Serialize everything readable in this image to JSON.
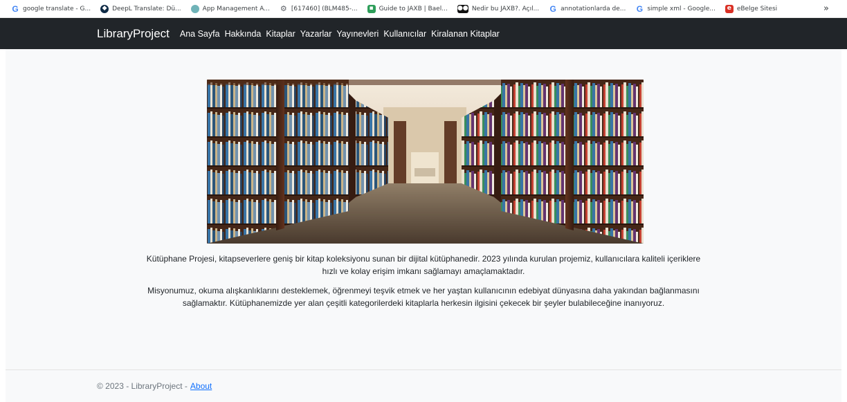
{
  "bookmarks": [
    {
      "label": "google translate - G...",
      "icon": "google-icon"
    },
    {
      "label": "DeepL Translate: Dü...",
      "icon": "deepl-icon"
    },
    {
      "label": "App Management A...",
      "icon": "app-icon"
    },
    {
      "label": "[617460] (BLM485-...",
      "icon": "gear-icon"
    },
    {
      "label": "Guide to JAXB | Bael...",
      "icon": "baeldung-icon"
    },
    {
      "label": "Nedir bu JAXB?. Açıl...",
      "icon": "medium-icon"
    },
    {
      "label": "annotationlarda de...",
      "icon": "google-icon"
    },
    {
      "label": "simple xml - Google...",
      "icon": "google-icon"
    },
    {
      "label": "eBelge Sitesi",
      "icon": "ebelge-icon"
    }
  ],
  "bookmarks_more": "»",
  "navbar": {
    "brand": "LibraryProject",
    "links": [
      "Ana Sayfa",
      "Hakkında",
      "Kitaplar",
      "Yazarlar",
      "Yayınevleri",
      "Kullanıcılar",
      "Kiralanan Kitaplar"
    ]
  },
  "content": {
    "paragraph1": "Kütüphane Projesi, kitapseverlere geniş bir kitap koleksiyonu sunan bir dijital kütüphanedir. 2023 yılında kurulan projemiz, kullanıcılara kaliteli içeriklere hızlı ve kolay erişim imkanı sağlamayı amaçlamaktadır.",
    "paragraph2": "Misyonumuz, okuma alışkanlıklarını desteklemek, öğrenmeyi teşvik etmek ve her yaştan kullanıcının edebiyat dünyasına daha yakından bağlanmasını sağlamaktır. Kütüphanemizde yer alan çeşitli kategorilerdeki kitaplarla herkesin ilgisini çekecek bir şeyler bulabileceğine inanıyoruz."
  },
  "footer": {
    "copyright": "© 2023 - LibraryProject -",
    "about_link": "About"
  }
}
